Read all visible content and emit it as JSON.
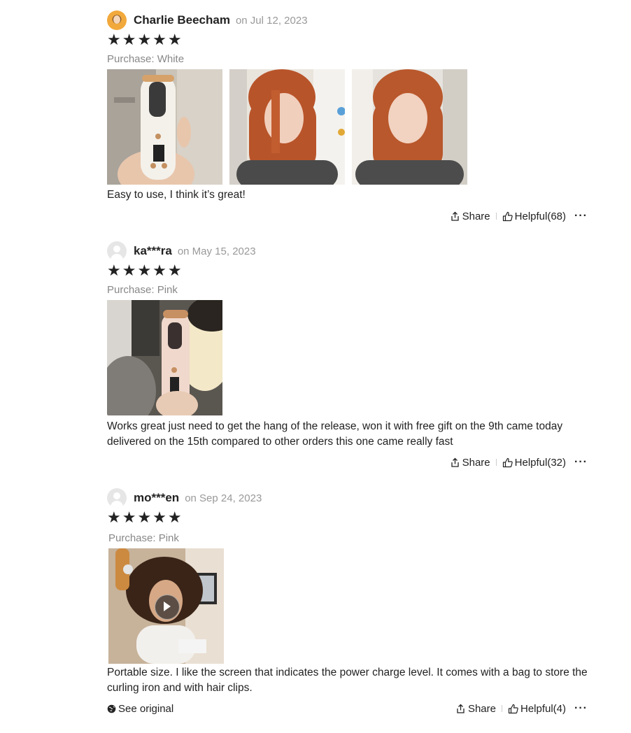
{
  "reviews": [
    {
      "reviewer": "Charlie Beecham",
      "date": "on Jul 12, 2023",
      "stars": "★★★★★",
      "purchase": "Purchase: White",
      "text": "Easy to use, I think it’s great!",
      "share": "Share",
      "helpful": "Helpful(68)",
      "more": "···"
    },
    {
      "reviewer": "ka***ra",
      "date": "on May 15, 2023",
      "stars": "★★★★★",
      "purchase": "Purchase: Pink",
      "text": "Works great just need to get the hang of the release, won it with free gift on the 9th came today delivered on the 15th compared to other orders this one came really fast",
      "share": "Share",
      "helpful": "Helpful(32)",
      "more": "···"
    },
    {
      "reviewer": "mo***en",
      "date": "on Sep 24, 2023",
      "stars": "★★★★★",
      "purchase": "Purchase: Pink",
      "text": "Portable size. I like the screen that indicates the power charge level. It comes with a bag to store the curling iron and with hair clips.",
      "share": "Share",
      "helpful": "Helpful(4)",
      "more": "···",
      "see_original": "See original"
    }
  ],
  "icons": {
    "share": "share-icon",
    "helpful": "thumbs-up-icon",
    "globe": "globe-icon",
    "play": "play-icon",
    "avatar": "user-avatar-icon"
  }
}
